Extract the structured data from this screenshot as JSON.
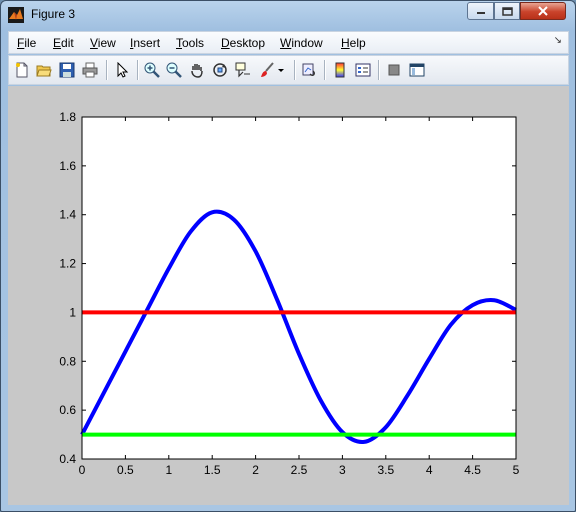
{
  "window": {
    "title": "Figure 3"
  },
  "menu": [
    "File",
    "Edit",
    "View",
    "Insert",
    "Tools",
    "Desktop",
    "Window",
    "Help"
  ],
  "menu_mnemonics": [
    "F",
    "E",
    "V",
    "I",
    "T",
    "D",
    "W",
    "H"
  ],
  "toolbar": {
    "items": [
      "new-figure-icon",
      "open-file-icon",
      "save-icon",
      "print-icon",
      "edit-plot-arrow-icon",
      "zoom-in-icon",
      "zoom-out-icon",
      "pan-hand-icon",
      "rotate-3d-icon",
      "data-cursor-icon",
      "brush-icon",
      "brush-dropdown-icon",
      "link-plot-icon",
      "insert-colorbar-icon",
      "insert-legend-icon",
      "hide-plot-tools-icon",
      "show-plot-tools-icon"
    ]
  },
  "chart_data": {
    "type": "line",
    "xlim": [
      0,
      5
    ],
    "ylim": [
      0.4,
      1.8
    ],
    "xticks": [
      0,
      0.5,
      1,
      1.5,
      2,
      2.5,
      3,
      3.5,
      4,
      4.5,
      5
    ],
    "yticks": [
      0.4,
      0.6,
      0.8,
      1,
      1.2,
      1.4,
      1.6,
      1.8
    ],
    "xtick_labels": [
      "0",
      "0.5",
      "1",
      "1.5",
      "2",
      "2.5",
      "3",
      "3.5",
      "4",
      "4.5",
      "5"
    ],
    "ytick_labels": [
      "0.4",
      "0.6",
      "0.8",
      "1",
      "1.2",
      "1.4",
      "1.6",
      "1.8"
    ],
    "grid": false,
    "series": [
      {
        "color": "#0000ff",
        "x": [
          0,
          0.25,
          0.5,
          0.75,
          1,
          1.25,
          1.5,
          1.75,
          2,
          2.25,
          2.5,
          2.75,
          3,
          3.25,
          3.5,
          3.75,
          4,
          4.25,
          4.5,
          4.75,
          5
        ],
        "y": [
          0.5,
          0.67,
          0.84,
          1.01,
          1.18,
          1.33,
          1.41,
          1.38,
          1.25,
          1.05,
          0.83,
          0.64,
          0.51,
          0.47,
          0.53,
          0.66,
          0.81,
          0.95,
          1.03,
          1.05,
          1.01
        ]
      },
      {
        "color": "#ff0000",
        "x": [
          0,
          5
        ],
        "y": [
          1,
          1
        ]
      },
      {
        "color": "#00ff00",
        "x": [
          0,
          5
        ],
        "y": [
          0.5,
          0.5
        ]
      }
    ]
  }
}
